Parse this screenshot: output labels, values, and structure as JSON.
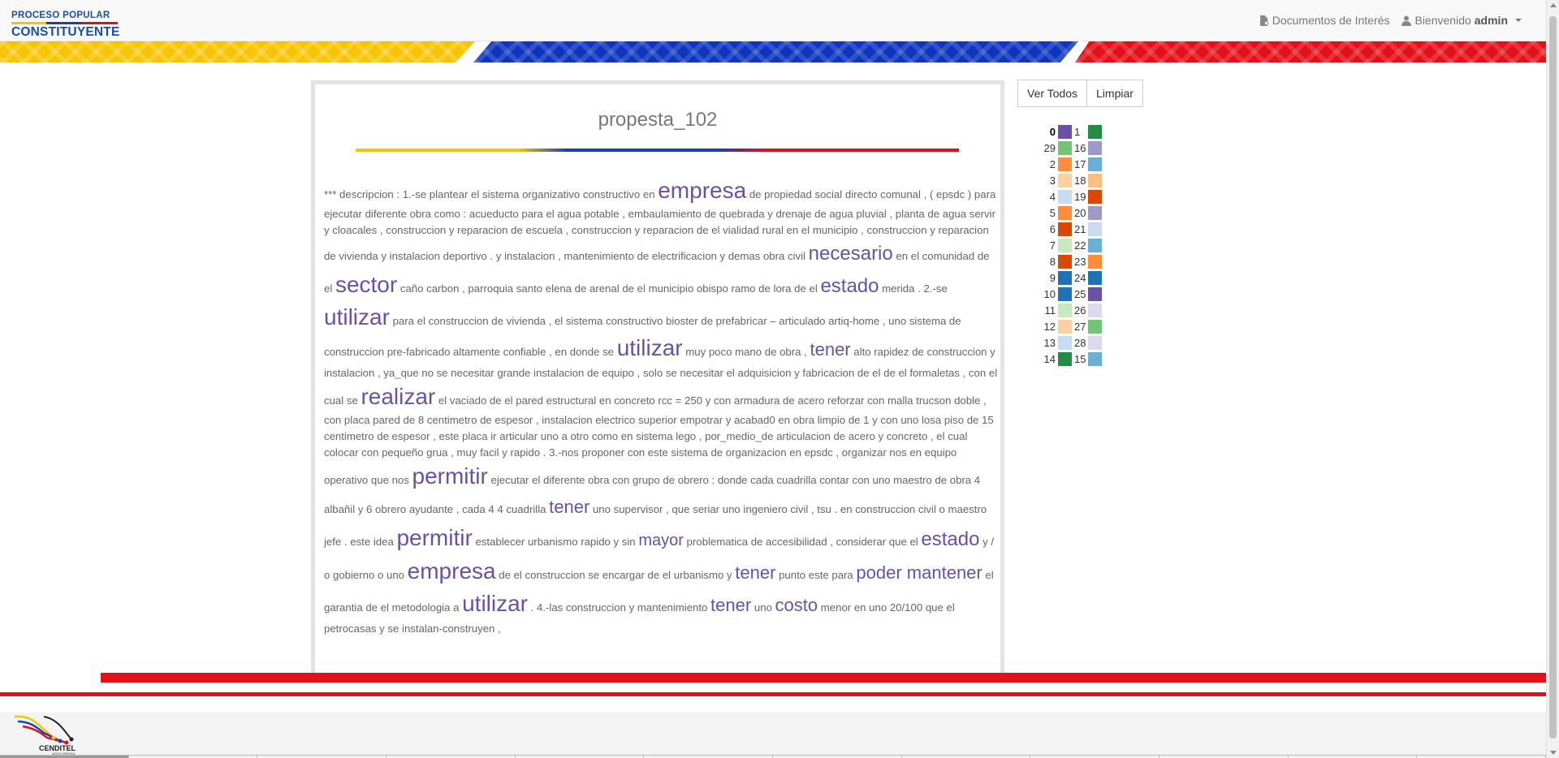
{
  "header": {
    "logo_top": "PROCESO POPULAR",
    "logo_bottom": "CONSTITUYENTE",
    "docs_label": "Documentos de Interés",
    "welcome_label": "Bienvenido",
    "user": "admin"
  },
  "document": {
    "title": "propesta_102",
    "segments": [
      {
        "t": " *** descripcion : 1.-se plantear el sistema organizativo constructivo en "
      },
      {
        "t": "empresa",
        "k": "w",
        "c": "#6a51a3"
      },
      {
        "t": " de propiedad social directo comunal , ( epsdc ) para ejecutar diferente obra como : acueducto para el agua potable , embaulamiento de quebrada y drenaje de agua pluvial , planta de agua servir y cloacales , construccion y reparacion de escuela , construccion y reparacion de el vialidad rural en el municipio , construccion y reparacion de vivienda y instalacion deportivo . y instalacion , mantenimiento de electrificacion y demas obra civil "
      },
      {
        "t": "necesario",
        "k": "w m",
        "c": "#6a51a3"
      },
      {
        "t": " en el comunidad de el "
      },
      {
        "t": "sector",
        "k": "w",
        "c": "#6a51a3"
      },
      {
        "t": " caño carbon , parroquia santo elena de arenal de el municipio obispo ramo de lora de el "
      },
      {
        "t": "estado",
        "k": "w m",
        "c": "#6a51a3"
      },
      {
        "t": " merida . 2.-se "
      },
      {
        "t": "utilizar",
        "k": "w",
        "c": "#6a51a3"
      },
      {
        "t": " para el construccion de vivienda , el sistema constructivo bioster de prefabricar – articulado artiq-home , uno sistema de construccion pre-fabricado altamente confiable , en donde se "
      },
      {
        "t": "utilizar",
        "k": "w",
        "c": "#6a51a3"
      },
      {
        "t": " muy poco mano de obra , "
      },
      {
        "t": "tener",
        "k": "w s",
        "c": "#6a51a3"
      },
      {
        "t": " alto rapidez de construccion y instalacion , ya_que no se necesitar grande instalacion de equipo , solo se necesitar el adquisicion y fabricacion de el de el formaletas , con el cual se "
      },
      {
        "t": "realizar",
        "k": "w",
        "c": "#6a51a3"
      },
      {
        "t": " el vaciado de el pared estructural en concreto rcc = 250 y con armadura de acero reforzar con malla trucson doble , con placa pared de 8 centimetro de espesor , instalacion electrico superior empotrar y acabad0 en obra limpio de 1 y con uno losa piso de 15 centimetro de espesor , este placa ir articular uno a otro como en sistema lego , por_medio_de articulacion de acero y concreto , el cual colocar con pequeño grua , muy facil y rapido . 3.-nos proponer con este sistema de organizacion en epsdc , organizar nos en equipo operativo que nos "
      },
      {
        "t": "permitir",
        "k": "w",
        "c": "#6a51a3"
      },
      {
        "t": " ejecutar el diferente obra con grupo de obrero : donde cada cuadrilla contar con uno maestro de obra 4 albañil y 6 obrero ayudante , cada 4 4 cuadrilla "
      },
      {
        "t": "tener",
        "k": "w s",
        "c": "#6a51a3"
      },
      {
        "t": " uno supervisor , que seriar uno ingeniero civil , tsu . en construccion civil o maestro jefe . este idea "
      },
      {
        "t": "permitir",
        "k": "w",
        "c": "#6a51a3"
      },
      {
        "t": " establecer urbanismo rapido y sin "
      },
      {
        "t": "mayor",
        "k": "w xs",
        "c": "#6a51a3"
      },
      {
        "t": " problematica de accesibilidad , considerar que el "
      },
      {
        "t": "estado",
        "k": "w m",
        "c": "#6a51a3"
      },
      {
        "t": " y / o gobierno o uno "
      },
      {
        "t": "empresa",
        "k": "w",
        "c": "#6a51a3"
      },
      {
        "t": " de el construccion se encargar de el urbanismo y "
      },
      {
        "t": "tener",
        "k": "w s",
        "c": "#6a51a3"
      },
      {
        "t": " punto este para "
      },
      {
        "t": "poder mantener",
        "k": "w s",
        "c": "#6a51a3"
      },
      {
        "t": " el garantia de el metodologia a "
      },
      {
        "t": "utilizar",
        "k": "w",
        "c": "#6a51a3"
      },
      {
        "t": " . 4.-las construccion y mantenimiento "
      },
      {
        "t": "tener",
        "k": "w s",
        "c": "#6a51a3"
      },
      {
        "t": " uno "
      },
      {
        "t": "costo",
        "k": "w s",
        "c": "#6a51a3"
      },
      {
        "t": " menor en uno 20/100 que el petrocasas y se instalan-construyen ,"
      }
    ]
  },
  "buttons": {
    "view_all": "Ver Todos",
    "clear": "Limpiar"
  },
  "legend": {
    "rows": [
      {
        "a": "0",
        "ac": "#6a51a3",
        "b": "1",
        "bc": "#238b45",
        "active": true
      },
      {
        "a": "29",
        "ac": "#74c476",
        "b": "16",
        "bc": "#9e9ac8"
      },
      {
        "a": "2",
        "ac": "#fd8d3c",
        "b": "17",
        "bc": "#6baed6"
      },
      {
        "a": "3",
        "ac": "#fdd0a2",
        "b": "18",
        "bc": "#fdbe85"
      },
      {
        "a": "4",
        "ac": "#c6dbef",
        "b": "19",
        "bc": "#d94801"
      },
      {
        "a": "5",
        "ac": "#fd8d3c",
        "b": "20",
        "bc": "#9e9ac8"
      },
      {
        "a": "6",
        "ac": "#d94801",
        "b": "21",
        "bc": "#c6dbef"
      },
      {
        "a": "7",
        "ac": "#c7e9c0",
        "b": "22",
        "bc": "#6baed6"
      },
      {
        "a": "8",
        "ac": "#d94801",
        "b": "23",
        "bc": "#fd8d3c"
      },
      {
        "a": "9",
        "ac": "#2171b5",
        "b": "24",
        "bc": "#2171b5"
      },
      {
        "a": "10",
        "ac": "#2171b5",
        "b": "25",
        "bc": "#6a51a3"
      },
      {
        "a": "11",
        "ac": "#c7e9c0",
        "b": "26",
        "bc": "#dadaeb"
      },
      {
        "a": "12",
        "ac": "#fdd0a2",
        "b": "27",
        "bc": "#74c476"
      },
      {
        "a": "13",
        "ac": "#c6dbef",
        "b": "28",
        "bc": "#dadaeb"
      },
      {
        "a": "14",
        "ac": "#238b45",
        "b": "15",
        "bc": "#6baed6"
      }
    ]
  },
  "footer": {
    "logo_text": "CENDITEL",
    "logo_sub": "NODO MÉRIDA"
  }
}
